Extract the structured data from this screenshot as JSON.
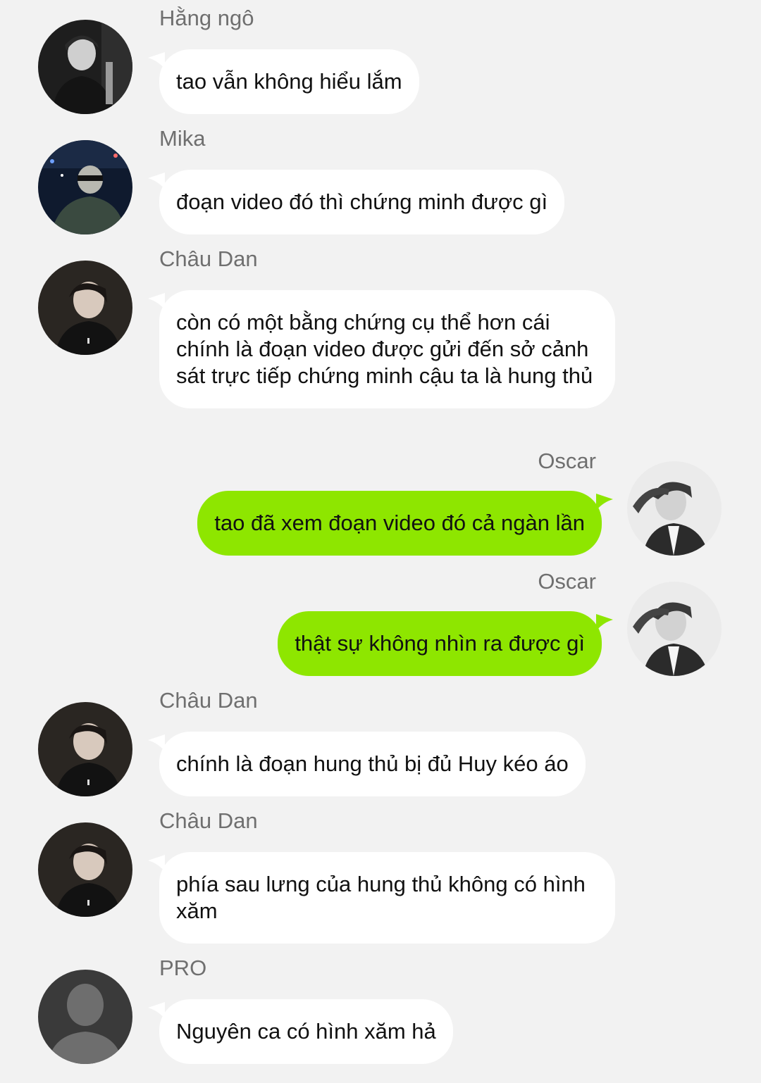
{
  "colors": {
    "background": "#f2f2f2",
    "incoming_bubble": "#ffffff",
    "outgoing_bubble": "#8ee600",
    "name_text": "#6f6f6f",
    "message_text": "#111111"
  },
  "messages": [
    {
      "sender": "Hằng ngô",
      "text": "tao vẫn không hiểu lắm",
      "side": "left",
      "avatar": "avatar-hang-ngo"
    },
    {
      "sender": "Mika",
      "text": "đoạn video đó thì chứng minh được gì",
      "side": "left",
      "avatar": "avatar-mika"
    },
    {
      "sender": "Châu Dan",
      "text": "còn có một bằng chứng cụ thể hơn cái chính là đoạn video được gửi đến sở cảnh sát trực tiếp chứng minh cậu ta là hung thủ",
      "side": "left",
      "avatar": "avatar-chau-dan"
    },
    {
      "sender": "Oscar",
      "text": "tao đã xem đoạn video đó cả ngàn lần",
      "side": "right",
      "avatar": "avatar-oscar"
    },
    {
      "sender": "Oscar",
      "text": "thật sự không nhìn ra được gì",
      "side": "right",
      "avatar": "avatar-oscar"
    },
    {
      "sender": "Châu Dan",
      "text": "chính là đoạn hung thủ bị đủ Huy kéo áo",
      "side": "left",
      "avatar": "avatar-chau-dan"
    },
    {
      "sender": "Châu Dan",
      "text": "phía sau lưng của hung thủ không có hình xăm",
      "side": "left",
      "avatar": "avatar-chau-dan"
    },
    {
      "sender": "PRO",
      "text": "Nguyên ca có hình xăm hả",
      "side": "left",
      "avatar": "default-avatar-icon"
    }
  ]
}
